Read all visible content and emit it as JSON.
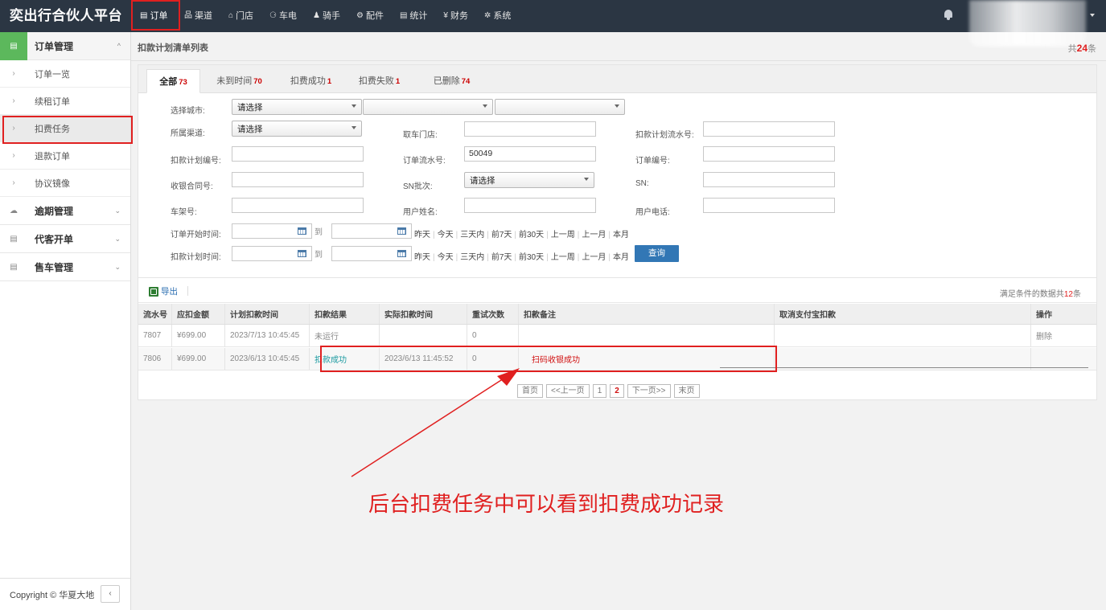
{
  "app": {
    "brand": "奕出行合伙人平台"
  },
  "topnav": [
    {
      "icon": "list-icon",
      "glyph": "▤",
      "label": "订单"
    },
    {
      "icon": "sitemap-icon",
      "glyph": "品",
      "label": "渠道"
    },
    {
      "icon": "home-icon",
      "glyph": "⌂",
      "label": "门店"
    },
    {
      "icon": "motorcycle-icon",
      "glyph": "⚆",
      "label": "车电"
    },
    {
      "icon": "users-icon",
      "glyph": "♟",
      "label": "骑手"
    },
    {
      "icon": "cogs-icon",
      "glyph": "⚙",
      "label": "配件"
    },
    {
      "icon": "chart-icon",
      "glyph": "▤",
      "label": "统计"
    },
    {
      "icon": "yen-icon",
      "glyph": "¥",
      "label": "财务"
    },
    {
      "icon": "gear-icon",
      "glyph": "✲",
      "label": "系统"
    }
  ],
  "sidebar": {
    "groups": [
      {
        "label": "订单管理",
        "icon": "order-icon",
        "glyph": "▤",
        "arrow": "^",
        "open": true,
        "items": [
          "订单一览",
          "续租订单",
          "扣费任务",
          "退款订单",
          "协议镜像"
        ]
      },
      {
        "label": "逾期管理",
        "icon": "cloud-icon",
        "glyph": "☁",
        "arrow": "⌄"
      },
      {
        "label": "代客开单",
        "icon": "table-icon",
        "glyph": "▤",
        "arrow": "⌄"
      },
      {
        "label": "售车管理",
        "icon": "table-icon",
        "glyph": "▤",
        "arrow": "⌄"
      }
    ],
    "copyright": "Copyright © 华夏大地",
    "collapse_glyph": "‹"
  },
  "page": {
    "title": "扣款计划清单列表",
    "total_prefix": "共",
    "total": "24",
    "total_suffix": "条"
  },
  "tabs": [
    {
      "label": "全部",
      "count": "73"
    },
    {
      "label": "未到时间",
      "count": "70"
    },
    {
      "label": "扣费成功",
      "count": "1"
    },
    {
      "label": "扣费失败",
      "count": "1"
    },
    {
      "label": "已删除",
      "count": "74"
    }
  ],
  "filters": {
    "city_label": "选择城市:",
    "city_select": "请选择",
    "city_select2": "",
    "city_select3": "",
    "channel_label": "所属渠道:",
    "channel_select": "请选择",
    "store_label": "取车门店:",
    "store_value": "",
    "plan_serial_label": "扣款计划流水号:",
    "plan_serial_value": "",
    "plan_no_label": "扣款计划编号:",
    "plan_no_value": "",
    "order_serial_label": "订单流水号:",
    "order_serial_value": "50049",
    "order_no_label": "订单编号:",
    "order_no_value": "",
    "contract_label": "收银合同号:",
    "contract_value": "",
    "sn_batch_label": "SN批次:",
    "sn_batch_select": "请选择",
    "sn_label": "SN:",
    "sn_value": "",
    "frame_label": "车架号:",
    "frame_value": "",
    "username_label": "用户姓名:",
    "username_value": "",
    "phone_label": "用户电话:",
    "phone_value": "",
    "order_start_label": "订单开始时间:",
    "plan_time_label": "扣款计划时间:",
    "to_label": "到",
    "quick_ranges": [
      "昨天",
      "今天",
      "三天内",
      "前7天",
      "前30天",
      "上一周",
      "上一月",
      "本月"
    ],
    "search_button": "查询"
  },
  "results": {
    "export_label": "导出",
    "match_prefix": "满足条件的数据共",
    "match_count": "12",
    "match_suffix": "条",
    "columns": [
      "流水号",
      "应扣金额",
      "计划扣款时间",
      "扣款结果",
      "实际扣款时间",
      "重试次数",
      "扣款备注",
      "取消支付宝扣款",
      "操作"
    ],
    "rows": [
      {
        "serial": "7807",
        "amount": "¥699.00",
        "plan_time": "2023/7/13 10:45:45",
        "result": "未运行",
        "actual_time": "",
        "retries": "0",
        "remark": "",
        "cancel": "",
        "op": "删除"
      },
      {
        "serial": "7806",
        "amount": "¥699.00",
        "plan_time": "2023/6/13 10:45:45",
        "result": "扣款成功",
        "actual_time": "2023/6/13 11:45:52",
        "retries": "0",
        "remark": "扫码收银成功",
        "cancel": "",
        "op": ""
      }
    ],
    "pager": [
      "首页",
      "<<上一页",
      "1",
      "2",
      "下一页>>",
      "末页"
    ],
    "current_page": "2"
  },
  "annotation": {
    "text": "后台扣费任务中可以看到扣费成功记录",
    "color": "#e02020"
  }
}
